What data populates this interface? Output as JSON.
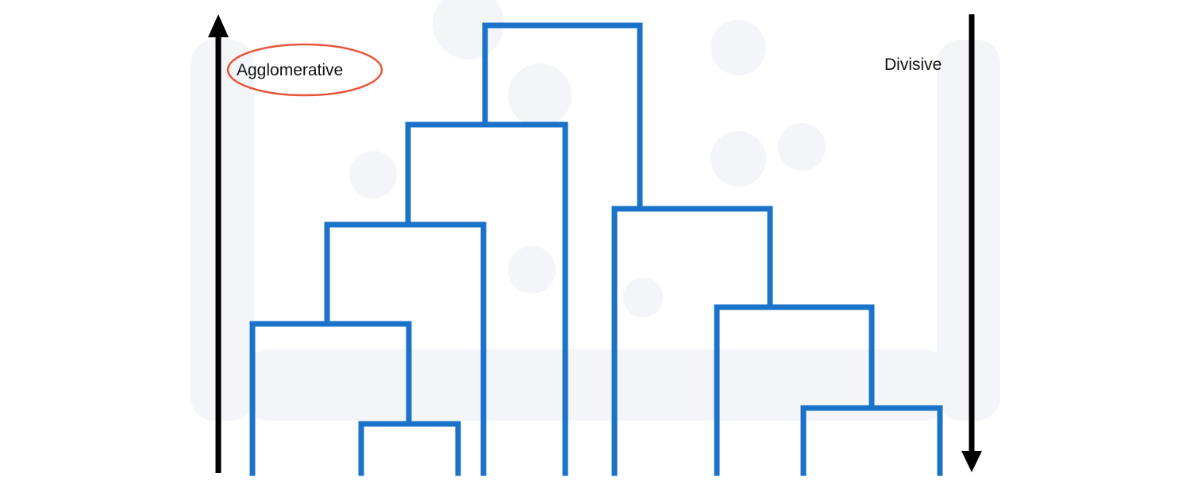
{
  "labels": {
    "agglomerative": "Agglomerative",
    "divisive": "Divisive"
  },
  "colors": {
    "dendrogram": "#1a73c9",
    "arrow": "#000000",
    "highlight_ellipse": "#e8553b",
    "background_watermark": "#f2f4f7"
  },
  "icons": {
    "agglomerative_arrow": "arrow-up-icon",
    "divisive_arrow": "arrow-down-icon"
  }
}
